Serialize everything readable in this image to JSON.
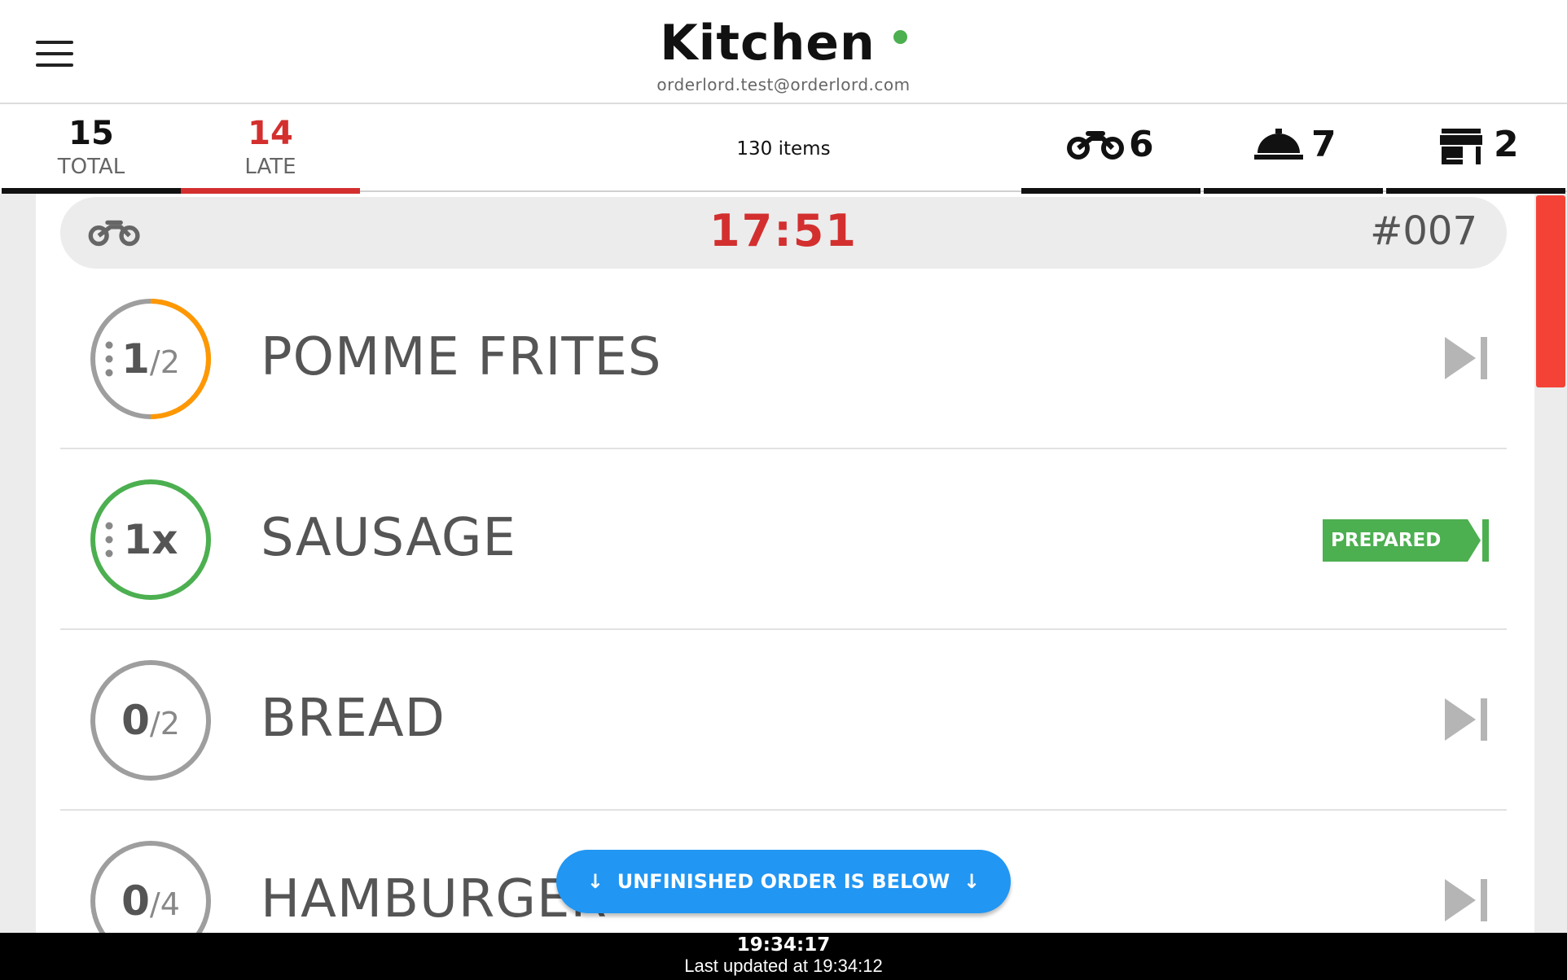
{
  "header": {
    "title": "Kitchen",
    "subtitle": "orderlord.test@orderlord.com",
    "status_color": "#4caf50",
    "menu_icon": "hamburger-menu-icon"
  },
  "tabs": {
    "total": {
      "count": "15",
      "label": "TOTAL"
    },
    "late": {
      "count": "14",
      "label": "LATE"
    },
    "items_count": "130 items",
    "delivery": {
      "icon": "motorbike-icon",
      "count": "6"
    },
    "dine_in": {
      "icon": "serving-cloche-icon",
      "count": "7"
    },
    "pickup": {
      "icon": "storefront-icon",
      "count": "2"
    }
  },
  "order": {
    "type_icon": "motorbike-icon",
    "time": "17:51",
    "number": "#007",
    "items": [
      {
        "qty": "1",
        "den": "/2",
        "name": "POMME FRITES",
        "action_icon": "skip-next-icon"
      },
      {
        "qty": "1x",
        "den": "",
        "name": "SAUSAGE",
        "action": "PREPARED"
      },
      {
        "qty": "0",
        "den": "/2",
        "name": "BREAD",
        "action_icon": "skip-next-icon"
      },
      {
        "qty": "0",
        "den": "/4",
        "name": "HAMBURGER",
        "action_icon": "skip-next-icon"
      }
    ]
  },
  "notice": {
    "label": "UNFINISHED ORDER IS BELOW"
  },
  "footer": {
    "clock": "19:34:17",
    "last_updated": "Last updated at 19:34:12"
  },
  "colors": {
    "late": "#d32f2f",
    "progress": "#ff9800",
    "prepared": "#4caf50",
    "notice": "#2196f3",
    "scroll_thumb": "#f44336"
  }
}
